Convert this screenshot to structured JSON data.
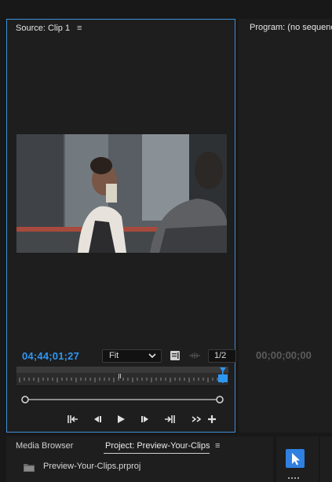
{
  "source_panel": {
    "tab_label": "Source: Clip 1",
    "menu_icon": "hamburger-icon",
    "timecode": "04;44;01;27",
    "zoom_select": "Fit",
    "resolution_select": "1/2",
    "accent_color": "#2f96ef",
    "transport": [
      "mark-in-icon",
      "step-back-icon",
      "play-icon",
      "step-forward-icon",
      "mark-out-icon",
      "more-icon",
      "add-icon"
    ]
  },
  "program_panel": {
    "tab_label": "Program: (no sequence",
    "timecode": "00;00;00;00"
  },
  "project_panel": {
    "tabs": [
      {
        "label": "Media Browser"
      },
      {
        "label": "Project: Preview-Your-Clips"
      }
    ],
    "items": [
      {
        "label": "Preview-Your-Clips.prproj",
        "icon": "project-file-icon"
      }
    ]
  },
  "tools_panel": {
    "active_tool": "selection-tool-icon",
    "active_color": "#2f80e0"
  }
}
